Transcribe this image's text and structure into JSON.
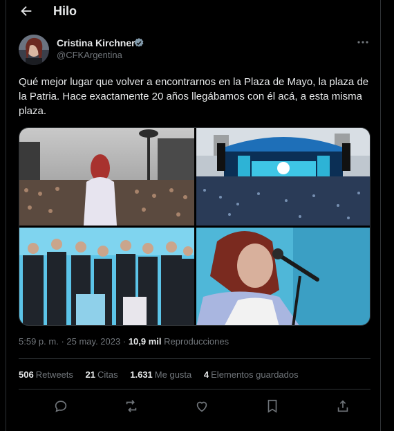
{
  "header": {
    "title": "Hilo"
  },
  "tweet": {
    "author_name": "Cristina Kirchner",
    "handle": "@CFKArgentina",
    "text": "Qué mejor lugar que volver a encontrarnos en la Plaza de Mayo, la plaza de la Patria. Hace exactamente 20 años llegábamos con él acá, a esta misma plaza.",
    "time": "5:59 p. m.",
    "separator": "·",
    "date": "25 may. 2023",
    "views_count": "10,9 mil",
    "views_label": "Reproducciones",
    "stats": [
      {
        "num": "506",
        "label": "Retweets"
      },
      {
        "num": "21",
        "label": "Citas"
      },
      {
        "num": "1.631",
        "label": "Me gusta"
      },
      {
        "num": "4",
        "label": "Elementos guardados"
      }
    ]
  },
  "icons": {
    "back": "arrow-left-icon",
    "verified": "verified-badge-icon",
    "more": "more-icon",
    "reply": "reply-icon",
    "retweet": "retweet-icon",
    "like": "heart-icon",
    "bookmark": "bookmark-icon",
    "share": "share-icon"
  },
  "colors": {
    "background": "#000000",
    "text": "#e7e9ea",
    "secondary_text": "#71767b",
    "border": "#2f3336",
    "verified_badge": "#829aab"
  }
}
